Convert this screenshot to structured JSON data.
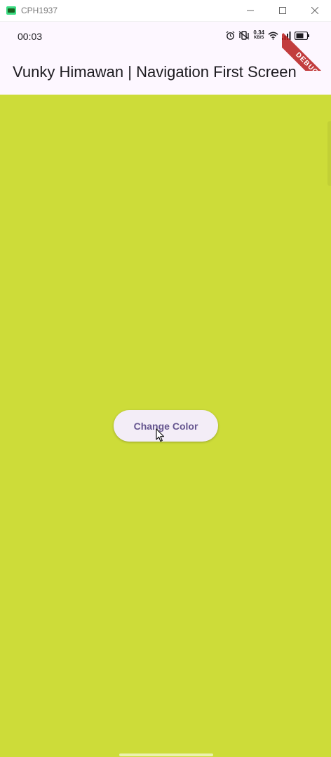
{
  "window": {
    "title": "CPH1937",
    "icon": "android-emulator-icon",
    "controls": [
      "minimize-icon",
      "maximize-icon",
      "close-icon"
    ]
  },
  "status_bar": {
    "time": "00:03",
    "net_speed_value": "0.34",
    "net_speed_unit": "KB/S",
    "icons": [
      "alarm-icon",
      "vibrate-icon",
      "wifi-icon",
      "signal-icon",
      "battery-icon"
    ]
  },
  "app_bar": {
    "title": "Vunky Himawan | Navigation First Screen"
  },
  "main": {
    "background_color": "#cddc39",
    "button_label": "Change Color"
  },
  "debug_banner": {
    "label": "DEBUG"
  },
  "colors": {
    "app_bar_bg": "#fdf7ff",
    "button_bg": "#f3edf7",
    "button_text": "#65558f",
    "debug_ribbon": "#b71c1c"
  }
}
